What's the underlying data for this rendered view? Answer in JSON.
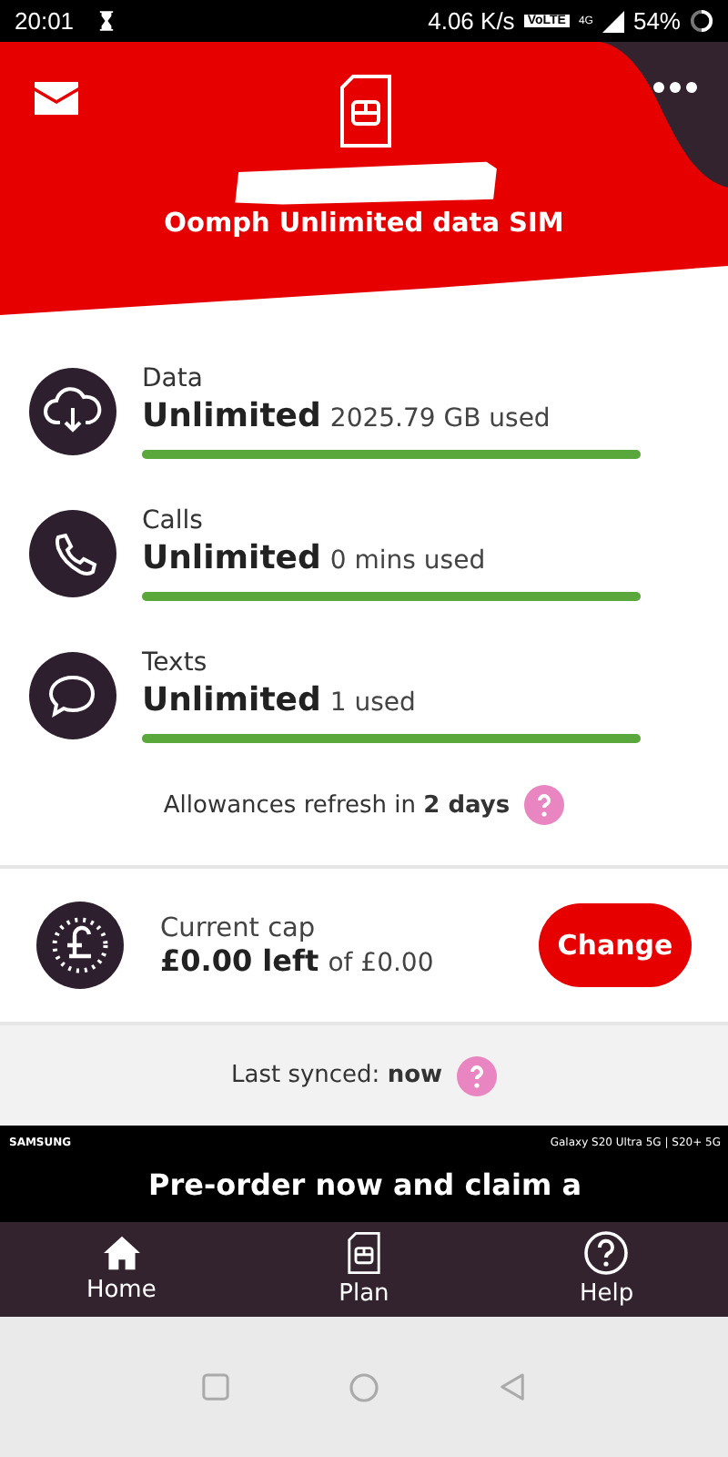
{
  "status_bar": {
    "time": "20:01",
    "speed": "4.06 K/s",
    "volte": "VoLTE",
    "network": "4G",
    "battery": "54%"
  },
  "header": {
    "plan_name": "Oomph Unlimited data SIM"
  },
  "allowances": [
    {
      "kind": "data",
      "label": "Data",
      "amount": "Unlimited",
      "usage": "2025.79 GB used",
      "level": 1
    },
    {
      "kind": "calls",
      "label": "Calls",
      "amount": "Unlimited",
      "usage": "0 mins used",
      "level": 1
    },
    {
      "kind": "texts",
      "label": "Texts",
      "amount": "Unlimited",
      "usage": "1 used",
      "level": 1
    }
  ],
  "refresh_note": "Allowances refresh in **2 days**",
  "cap": {
    "label": "Current cap",
    "amount": "£0.00 left",
    "of": "of £0.00",
    "button": "Change"
  },
  "sync_note": "Last synced: **now**",
  "ad": {
    "brand": "SAMSUNG",
    "models": "Galaxy S20 Ultra 5G | S20+ 5G",
    "headline": "Pre-order now and claim a"
  },
  "bottom_nav": [
    {
      "kind": "home",
      "label": "Home"
    },
    {
      "kind": "plan",
      "label": "Plan"
    },
    {
      "kind": "help",
      "label": "Help"
    }
  ]
}
